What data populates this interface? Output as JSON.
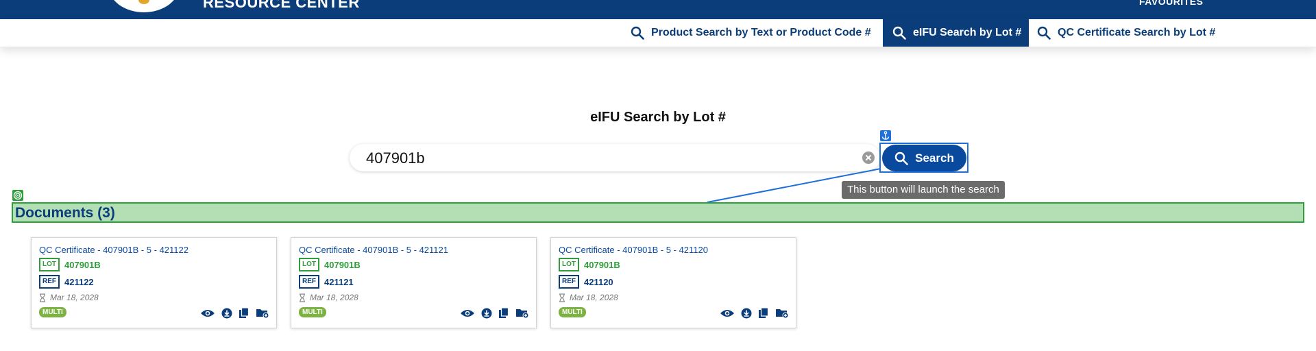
{
  "header": {
    "brand_text": "RESOURCE CENTER",
    "favourites_label": "FAVOURITES"
  },
  "nav": {
    "tabs": [
      {
        "label": "Product Search by Text or Product Code #",
        "active": false
      },
      {
        "label": "eIFU Search by Lot #",
        "active": true
      },
      {
        "label": "QC Certificate Search by Lot #",
        "active": false
      }
    ]
  },
  "search": {
    "title": "eIFU Search by Lot #",
    "value": "407901b",
    "button_label": "Search",
    "tooltip": "This button will launch the search"
  },
  "documents": {
    "header": "Documents (3)",
    "items": [
      {
        "title": "QC Certificate - 407901B - 5 - 421122",
        "lot_badge": "LOT",
        "lot": "407901B",
        "ref_badge": "REF",
        "ref": "421122",
        "date": "Mar 18, 2028",
        "tag": "MULTI"
      },
      {
        "title": "QC Certificate - 407901B - 5 - 421121",
        "lot_badge": "LOT",
        "lot": "407901B",
        "ref_badge": "REF",
        "ref": "421121",
        "date": "Mar 18, 2028",
        "tag": "MULTI"
      },
      {
        "title": "QC Certificate - 407901B - 5 - 421120",
        "lot_badge": "LOT",
        "lot": "407901B",
        "ref_badge": "REF",
        "ref": "421120",
        "date": "Mar 18, 2028",
        "tag": "MULTI"
      }
    ]
  },
  "colors": {
    "brand_navy": "#0a3d7a",
    "button_blue": "#0a4a9e",
    "lot_green": "#2e9e3a",
    "tag_green": "#7cb342",
    "annotation_blue": "#1e6fd9",
    "docs_highlight": "#b4dfb4"
  },
  "icons": {
    "tab_icon": "search-icon",
    "clear": "clear-circle-icon",
    "card_actions": [
      "eye-icon",
      "download-icon",
      "copy-icon",
      "folder-add-icon"
    ],
    "date": "hourglass-icon"
  }
}
